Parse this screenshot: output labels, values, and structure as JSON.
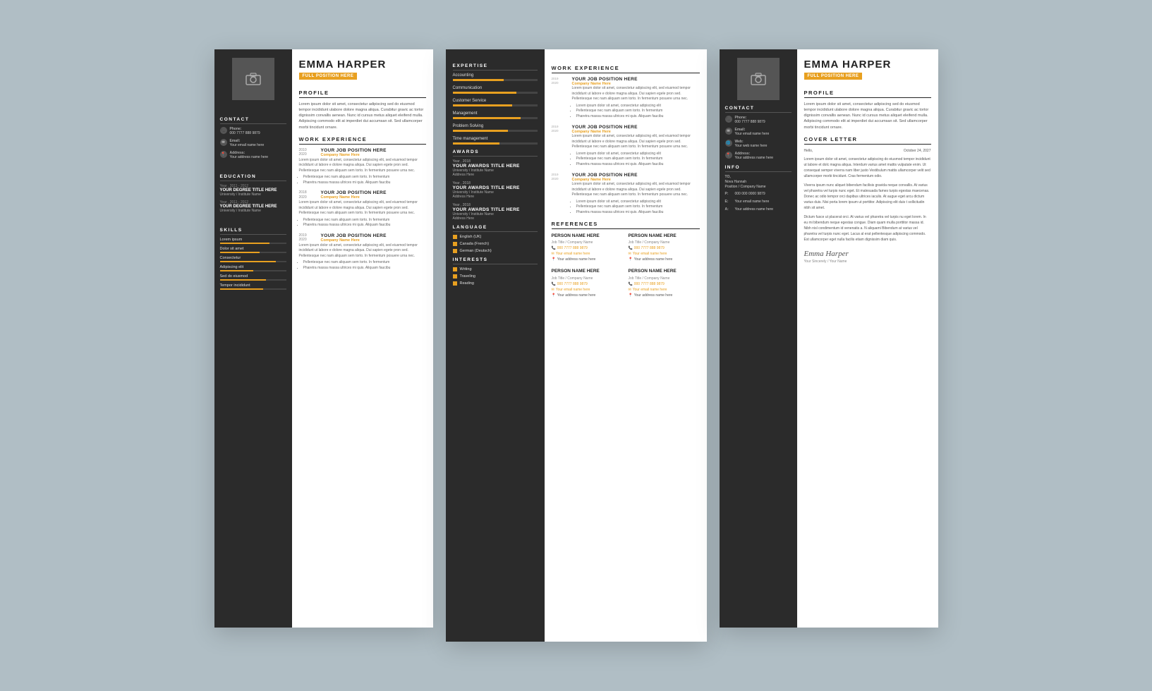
{
  "background_color": "#b0bec5",
  "accent_color": "#e8a020",
  "dark_color": "#2b2b2b",
  "resume": {
    "name": "EMMA HARPER",
    "position": "FULL POSITION HERE",
    "profile_text": "Lorem ipsum dolor sit amet, consectetur adipiscing sed do eiusmod tempor incididunt ulabore dolore magna aliqua. Curabitur gravic ac tortor dignissim convallis aenean. Nunc id cursus metus aliquet eleifend mulla. Adipiscing commodo elit at imperdiet dui accumsan sit. Sed ullamcorper morbi tincidunt ornare.",
    "contact": {
      "phone_label": "Phone:",
      "phone": "000 7777 888 9879",
      "email_label": "Email:",
      "email": "Your email name here",
      "web_label": "Web:",
      "web": "Your web name here",
      "address_label": "Address:",
      "address": "Your address name here"
    },
    "education": [
      {
        "year": "Year , 2011 - 2012",
        "degree": "YOUR DEGREE TITLE HERE",
        "university": "University / Institute Name"
      },
      {
        "year": "Year , 2011 - 2012",
        "degree": "YOUR DEGREE TITLE HERE",
        "university": "University / Institute Name"
      }
    ],
    "skills": [
      {
        "name": "Lorem ipsum",
        "level": 75
      },
      {
        "name": "Dolor sit amet",
        "level": 60
      },
      {
        "name": "Consectetur",
        "level": 85
      },
      {
        "name": "Adipiscing elit",
        "level": 50
      },
      {
        "name": "Sed do eiusmod",
        "level": 70
      },
      {
        "name": "Tempor incididunt",
        "level": 65
      }
    ],
    "work_experience": [
      {
        "year_start": "2010",
        "year_end": "2020",
        "title": "YOUR JOB POSITION HERE",
        "company": "Company Name Here",
        "desc": "Lorem ipsum dolor sit amet, consectetur adipiscing elit, sed eiusmod tempor incididunt ut labore e dolore magna aliqua. Dui sapien egete pron sed. Pellentesque nec nam aliquam sem torto. In fermentum posuere urna nec.",
        "bullets": [
          "Pellentesque nec nam aliquam sem torto. In fermentum",
          "Pharetra massa massa ultrices mi quis. Aliquam faucibu"
        ]
      },
      {
        "year_start": "2018",
        "year_end": "2020",
        "title": "YOUR JOB POSITION HERE",
        "company": "Company Name Here",
        "desc": "Lorem ipsum dolor sit amet, consectetur adipiscing elit, sed eiusmod tempor incididunt ut labore e dolore magna aliqua. Dui sapien egete pron sed. Pellentesque nec nam aliquam sem torto. In fermentum posuere urna nec.",
        "bullets": [
          "Pellentesque nec nam aliquam sem torto. In fermentum",
          "Pharetra massa massa ultrices mi quis. Aliquam faucibu"
        ]
      },
      {
        "year_start": "2019",
        "year_end": "2020",
        "title": "YOUR JOB POSITION HERE",
        "company": "Company Name Here",
        "desc": "Lorem ipsum dolor sit amet, consectetur adipiscing elit, sed eiusmod tempor incididunt ut labore e dolore magna aliqua. Dui sapien egete pron sed. Pellentesque nec nam aliquam sem torto. In fermentum posuere urna nec.",
        "bullets": [
          "Pellentesque nec nam aliquam sem torto. In fermentum",
          "Pharetra massa massa ultrices mi quis. Aliquam faucibu"
        ]
      }
    ]
  },
  "middle": {
    "expertise": [
      {
        "label": "Accounting",
        "level": 60
      },
      {
        "label": "Communication",
        "level": 75
      },
      {
        "label": "Customer Service",
        "level": 70
      },
      {
        "label": "Management",
        "level": 80
      },
      {
        "label": "Problem Solving",
        "level": 65
      },
      {
        "label": "Time management",
        "level": 55
      }
    ],
    "awards": [
      {
        "year": "Year , 2018",
        "title": "YOUR AWARDS TITLE HERE",
        "university": "University / Institute Name",
        "address": "Address Here"
      },
      {
        "year": "Year , 2018",
        "title": "YOUR AWARDS TITLE HERE",
        "university": "University / Institute Name",
        "address": "Address Here"
      },
      {
        "year": "Year , 2018",
        "title": "YOUR AWARDS TITLE HERE",
        "university": "University / Institute Name",
        "address": "Address Here"
      }
    ],
    "languages": [
      "English (UK)",
      "Canada (French)",
      "German (Deutsch)"
    ],
    "interests": [
      "Writing",
      "Traveling",
      "Reading"
    ],
    "work_experience": [
      {
        "year_start": "2019",
        "year_end": "2020",
        "title": "YOUR JOB POSITION HERE",
        "company": "Company Name Here",
        "desc": "Lorem ipsum dolor sit amet, consectetur adipiscing elit, sed eiusmod tempor incididunt ut labore e dolore magna aliqua. Dui sapien egele pron sed. Pellentesque nec nam aliquam sem torto. In fermentum posuere urna nec.",
        "bullets": [
          "Lorem ipsum dolor sit amet, consectetur adipiscing elit",
          "Pellentesque nec nam aliquam sem torto. In fermentum",
          "Pharetra massa massa ultrices mi quis. Aliquam faucibu"
        ]
      },
      {
        "year_start": "2019",
        "year_end": "2020",
        "title": "YOUR JOB POSITION HERE",
        "company": "Company Name Here",
        "desc": "Lorem ipsum dolor sit amet, consectetur adipiscing elit, sed eiusmod tempor incididunt ut labore e dolore magna aliqua. Dui sapien egele pron sed. Pellentesque nec nam aliquam sem torto. In fermentum posuere urna nec.",
        "bullets": [
          "Lorem ipsum dolor sit amet, consectetur adipiscing elit",
          "Pellentesque nec nam aliquam sem torto. In fermentum",
          "Pharetra massa massa ultrices mi quis. Aliquam faucibu"
        ]
      },
      {
        "year_start": "2019",
        "year_end": "2020",
        "title": "YOUR JOB POSITION HERE",
        "company": "Company Name Here",
        "desc": "Lorem ipsum dolor sit amet, consectetur adipiscing elit, sed eiusmod tempor incididunt ut labore e dolore magna aliqua. Dui sapien egele pron sed. Pellentesque nec nam aliquam sem torto. In fermentum posuere urna nec.",
        "bullets": [
          "Lorem ipsum dolor sit amet, consectetur adipiscing elit",
          "Pellentesque nec nam aliquam sem torto. In fermentum",
          "Pharetra massa massa ultrices mi quis. Aliquam faucibu"
        ]
      }
    ],
    "references": [
      {
        "name": "PERSON NAME HERE",
        "title": "Job Title / Company Name",
        "phone": "000 7777 888 9879",
        "email": "Your email name here",
        "address": "Your address name here"
      },
      {
        "name": "PERSON NAME HERE",
        "title": "Job Title / Company Name",
        "phone": "000 7777 888 9879",
        "email": "Your email name here",
        "address": "Your address name here"
      },
      {
        "name": "PERSON NAME HERE",
        "title": "Job Title / Company Name",
        "phone": "000 7777 888 9879",
        "email": "Your email name here",
        "address": "Your address name here"
      },
      {
        "name": "PERSON NAME HERE",
        "title": "Job Title / Company Name",
        "phone": "000 7777 888 9879",
        "email": "Your email name here",
        "address": "Your address name here"
      }
    ]
  },
  "cover": {
    "name": "EMMA HARPER",
    "position": "FULL POSITION HERE",
    "profile_text": "Lorem ipsum dolor sit amet, consectetur adipiscing sed do eiusmod tempor incididunt ulabore dolore magna aliqua. Curabitur gravic ac tortor dignissim convallis aenean. Nunc id cursus metus aliquet eleifend mulla. Adipiscing commodo elit at imperdiet dui accumsan sit. Sed ullamcorper morbi tincidunt ornare.",
    "contact": {
      "phone_label": "Phone:",
      "phone": "000 7777 888 9879",
      "email_label": "Email:",
      "email": "Your email name here",
      "web_label": "Web:",
      "web": "Your web name here",
      "address_label": "Address:",
      "address": "Your address name here"
    },
    "info": {
      "to": "Nova Hannah",
      "position": "Position / Company Name",
      "phone_label": "P:",
      "phone": "000 000 0000 9879",
      "email_label": "E:",
      "email": "Your email name here",
      "address_label": "A:",
      "address": "Your address name here"
    },
    "letter": {
      "greeting": "Hello,",
      "date": "October 24, 2027",
      "body1": "Lorem ipsum dolor sit amet, consectetur adipiscing do eiusmod tempor incididunt ut labore et dolc magna aliqua. Interdum varius amet mattis vulputate enim. Ut consequat semper viverra nam liber justo Vestibulum mattis ullamcorper velit sed ullamcorper morbi tincidunt. Cras fermentum odio.",
      "body2": "Viverra ipsum nunc aliquet bibendum facilisis gravida neque convallis. At varius vel pharetra vel turpis nunc eget. Et malesuada fames turpis egestas maecenas. Donec ac odio tempor orci dapibus ultrices iaculis. At augue eget arcu dictum varius duis. Nisi porta lorem ipsum ut porttitor. Adipiscing elit duis t sollicitudin nibh sit amet.",
      "body3": "Dictum fusce ut placerat orci. At varius vel pharetra vel turpis nu eget lorem. In eu mi bibendum neque egestas congue. Diam quam mulla porttitor massa id. Nibh nisl condimentum id venenatis a. N aliquami Bibendum at varius vel pharetra vel turpis nunc eget. Lacus al erat pellentesque adipiscing commodo. Est ullamcorper eget nulla facilis etiam dignissim diam quis.",
      "closing": "Your Sincerely / Your Name",
      "signature": "Emma Harper"
    }
  },
  "sections": {
    "profile": "PROFILE",
    "contact": "CONTACT",
    "education": "EDUCATION",
    "skills": "SKILLS",
    "work_experience": "WORK EXPERIENCE",
    "expertise": "EXPERTISE",
    "awards": "AWARDS",
    "language": "LANGUAGE",
    "interests": "INTERESTS",
    "references": "REFERENCES",
    "cover_letter": "COVER LETTER",
    "info": "INFO"
  }
}
